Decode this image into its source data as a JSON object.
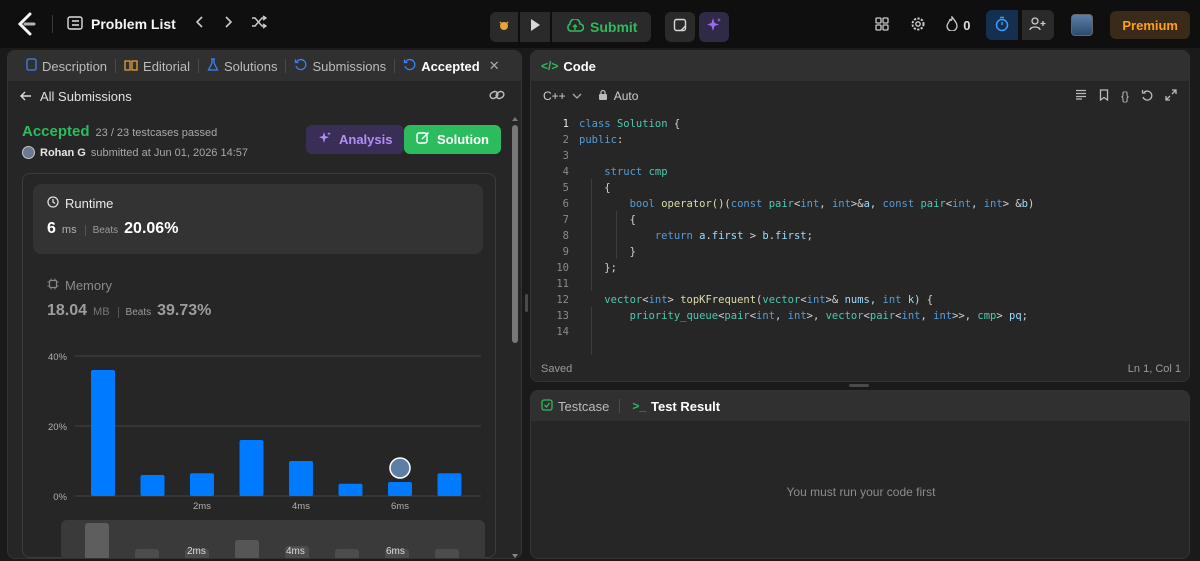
{
  "topbar": {
    "title": "Problem List",
    "submit_label": "Submit",
    "streak": "0",
    "premium_label": "Premium"
  },
  "left": {
    "tabs": [
      {
        "label": "Description"
      },
      {
        "label": "Editorial"
      },
      {
        "label": "Solutions"
      },
      {
        "label": "Submissions"
      },
      {
        "label": "Accepted"
      }
    ],
    "back_label": "All Submissions",
    "status": "Accepted",
    "testcases": "23 / 23 testcases passed",
    "user": "Rohan G",
    "submitted": "submitted at Jun 01, 2026 14:57",
    "analysis_label": "Analysis",
    "solution_label": "Solution",
    "runtime": {
      "label": "Runtime",
      "value": "6",
      "unit": "ms",
      "beats_label": "Beats",
      "beats": "20.06%"
    },
    "memory": {
      "label": "Memory",
      "value": "18.04",
      "unit": "MB",
      "beats_label": "Beats",
      "beats": "39.73%"
    }
  },
  "chart_data": {
    "type": "bar",
    "title": "",
    "ylabel": "",
    "ylim": [
      0,
      40
    ],
    "ytick_labels": [
      "40%",
      "20%",
      "0%"
    ],
    "xtick_labels": [
      "2ms",
      "4ms",
      "6ms"
    ],
    "values": [
      36,
      6,
      6.5,
      16,
      10,
      3.5,
      4,
      6.5
    ],
    "highlight_index": 6,
    "bar_color": "#007aff",
    "grid": true
  },
  "mini_chart": {
    "xtick_labels": [
      "2ms",
      "4ms",
      "6ms"
    ]
  },
  "code_panel": {
    "title": "Code",
    "language": "C++",
    "mode": "Auto",
    "status": "Saved",
    "cursor": "Ln 1, Col 1",
    "lines": [
      {
        "n": "1"
      },
      {
        "n": "2"
      },
      {
        "n": "3"
      },
      {
        "n": "4"
      },
      {
        "n": "5"
      },
      {
        "n": "6"
      },
      {
        "n": "7"
      },
      {
        "n": "8"
      },
      {
        "n": "9"
      },
      {
        "n": "10"
      },
      {
        "n": "11"
      },
      {
        "n": "12"
      },
      {
        "n": "13"
      },
      {
        "n": "14"
      }
    ]
  },
  "bottom": {
    "tab_testcase": "Testcase",
    "tab_result": "Test Result",
    "message": "You must run your code first"
  },
  "colors": {
    "accent": "#2cbb5d",
    "premium": "#ffa116",
    "bar": "#007aff",
    "analysis": "#b48ef7"
  }
}
